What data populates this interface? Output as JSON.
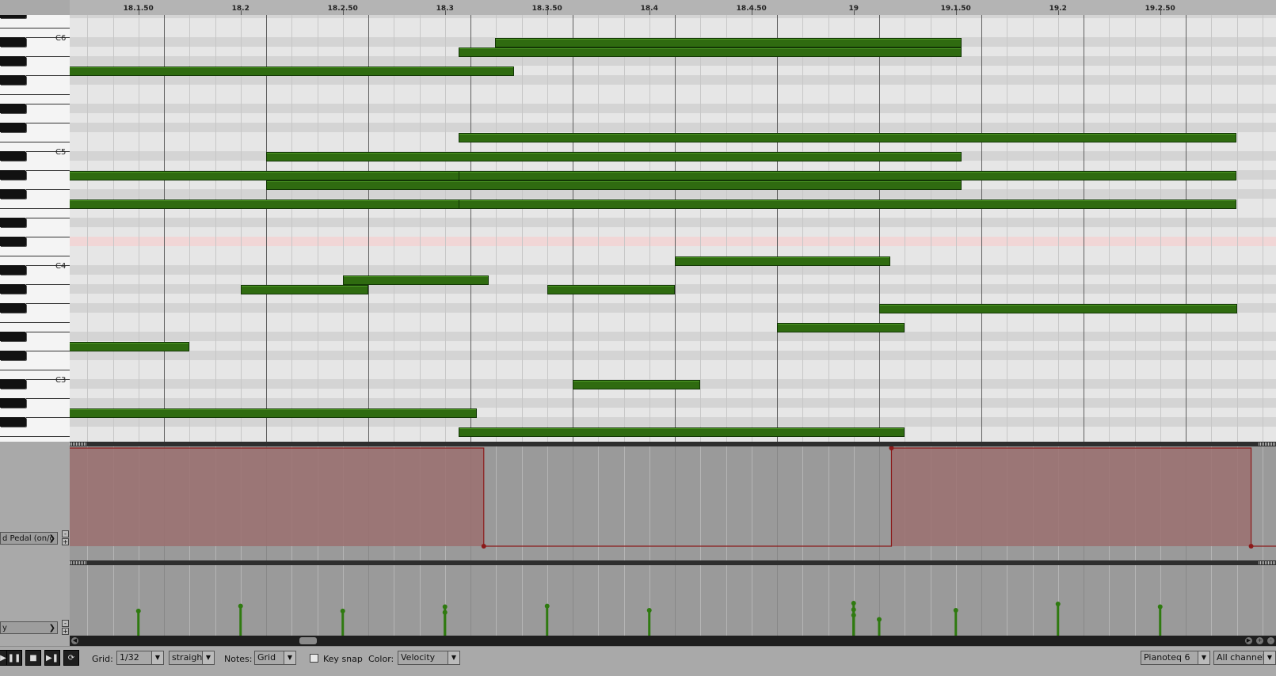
{
  "ruler": {
    "labels": [
      "18.1.50",
      "18.2",
      "18.2.50",
      "18.3",
      "18.3.50",
      "18.4",
      "18.4.50",
      "19",
      "19.1.50",
      "19.2",
      "19.2.50"
    ]
  },
  "keyboard": {
    "octave_labels": [
      "C6",
      "C5",
      "C4",
      "C3"
    ]
  },
  "notes": [
    {
      "row": 3,
      "start": 4.24,
      "end": 8.81
    },
    {
      "row": 4,
      "start": 3.88,
      "end": 8.81
    },
    {
      "row": 6,
      "start": -0.1,
      "end": 4.43
    },
    {
      "row": 13,
      "start": 3.88,
      "end": 11.5
    },
    {
      "row": 15,
      "start": 2.0,
      "end": 8.81
    },
    {
      "row": 17,
      "start": -0.1,
      "end": 4.43
    },
    {
      "row": 17,
      "start": 3.88,
      "end": 11.5
    },
    {
      "row": 18,
      "start": 2.0,
      "end": 8.81
    },
    {
      "row": 20,
      "start": -0.1,
      "end": 4.43
    },
    {
      "row": 20,
      "start": 3.88,
      "end": 11.5
    },
    {
      "row": 26,
      "start": 6.0,
      "end": 8.11
    },
    {
      "row": 28,
      "start": 2.75,
      "end": 4.18
    },
    {
      "row": 29,
      "start": 1.75,
      "end": 3.0
    },
    {
      "row": 29,
      "start": 4.75,
      "end": 6.0
    },
    {
      "row": 31,
      "start": 8.0,
      "end": 11.5
    },
    {
      "row": 33,
      "start": 7.0,
      "end": 8.25
    },
    {
      "row": 35,
      "start": 0.0,
      "end": 1.25
    },
    {
      "row": 39,
      "start": 5.0,
      "end": 6.25
    },
    {
      "row": 42,
      "start": -0.1,
      "end": 4.06
    },
    {
      "row": 44,
      "start": 3.88,
      "end": 8.25
    }
  ],
  "cc_lane": {
    "label": "d Pedal (on/o",
    "blocks": [
      {
        "start": -0.1,
        "end": 4.13
      },
      {
        "start": 8.12,
        "end": 11.64
      }
    ]
  },
  "velocity_lane": {
    "label": "y",
    "stems": [
      {
        "x": 0.75,
        "v": 0.35
      },
      {
        "x": 1.75,
        "v": 0.42
      },
      {
        "x": 2.75,
        "v": 0.35
      },
      {
        "x": 3.75,
        "v": 0.41
      },
      {
        "x": 3.75,
        "v": 0.33
      },
      {
        "x": 4.75,
        "v": 0.42
      },
      {
        "x": 5.75,
        "v": 0.36
      },
      {
        "x": 7.75,
        "v": 0.46
      },
      {
        "x": 7.75,
        "v": 0.37
      },
      {
        "x": 7.75,
        "v": 0.29
      },
      {
        "x": 8.0,
        "v": 0.23
      },
      {
        "x": 8.75,
        "v": 0.36
      },
      {
        "x": 9.75,
        "v": 0.45
      },
      {
        "x": 10.75,
        "v": 0.41
      }
    ]
  },
  "toolbar": {
    "grid_label": "Grid:",
    "grid_value": "1/32",
    "swing_value": "straight",
    "notes_label": "Notes:",
    "notes_value": "Grid",
    "keysnap_label": "Key snap",
    "color_label": "Color:",
    "color_value": "Velocity",
    "instrument_value": "Pianoteq 6",
    "channel_value": "All channels"
  },
  "colors": {
    "note": "#2f6b10",
    "cc_fill": "#9b7070",
    "cc_line": "#8b1a1a",
    "velocity_stem": "#2f7a10"
  }
}
